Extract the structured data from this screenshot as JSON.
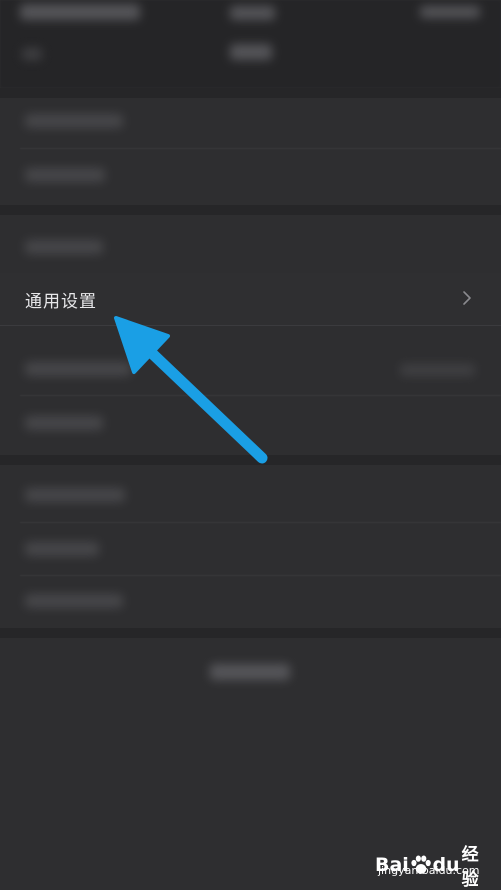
{
  "settings": {
    "general_label": "通用设置"
  },
  "watermark": {
    "brand_bai": "Bai",
    "brand_du": "du",
    "brand_cn": "经验",
    "url": "jingyan.baidu.com"
  },
  "colors": {
    "background": "#2e2e30",
    "arrow": "#1a9fe5",
    "text": "#e8e8ea"
  }
}
